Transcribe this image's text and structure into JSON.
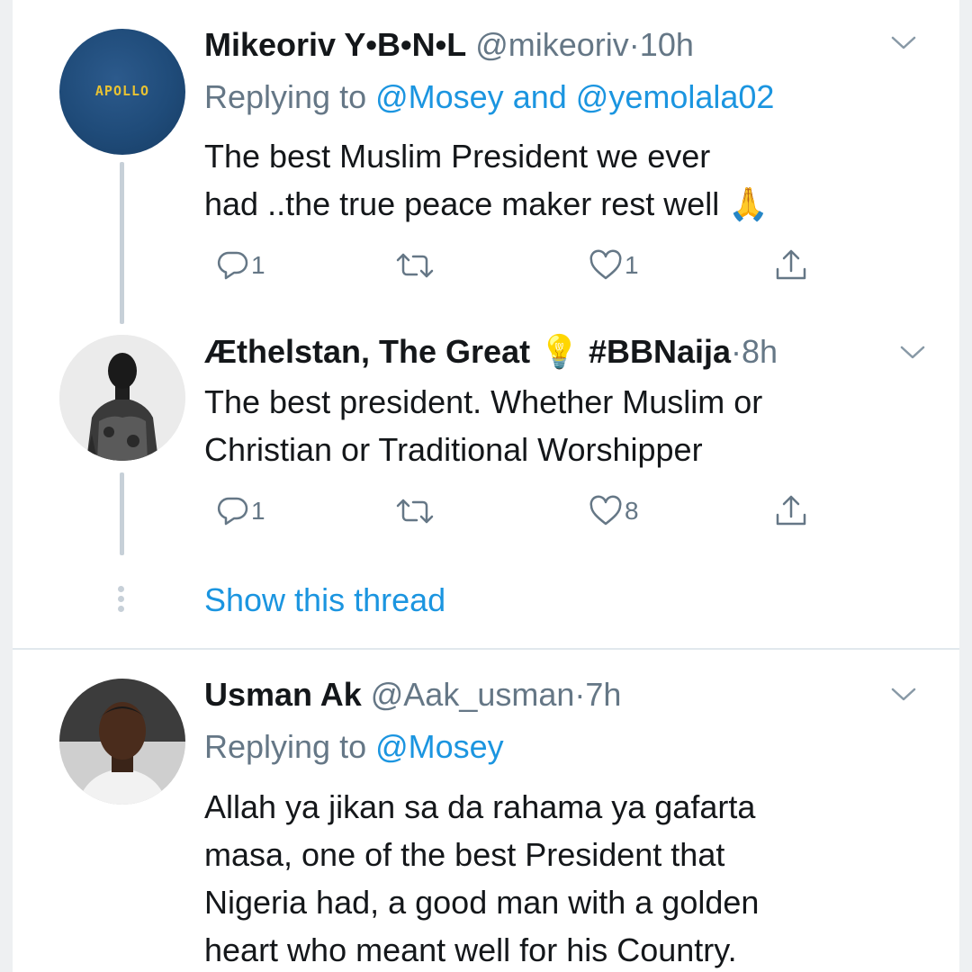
{
  "tweets": [
    {
      "name": "Mikeoriv Y•B•N•L",
      "handle": "@mikeoriv",
      "sep": "·",
      "time": "10h",
      "replying_prefix": "Replying to ",
      "replying_mentions": [
        "@Mosey",
        "and",
        "@yemolala02"
      ],
      "body_lines": [
        "The best Muslim President we ever",
        "had ..the true peace maker rest well"
      ],
      "emoji": "🙏",
      "avatar_text": "APOLLO",
      "reply_count": "1",
      "like_count": "1"
    },
    {
      "name": "Æthelstan, The Great",
      "emoji": "💡",
      "hashtag": "#BBNaija",
      "sep": "·",
      "time": "8h",
      "body_lines": [
        "The best president. Whether Muslim or",
        "Christian or Traditional Worshipper"
      ],
      "reply_count": "1",
      "like_count": "8"
    },
    {
      "name": "Usman Ak",
      "handle": "@Aak_usman",
      "sep": "·",
      "time": "7h",
      "replying_prefix": "Replying to ",
      "replying_mentions": [
        "@Mosey"
      ],
      "body_lines": [
        "Allah ya jikan sa da rahama ya gafarta",
        "masa, one of the best President that",
        "Nigeria had, a good man with a golden",
        "heart who meant well for his Country."
      ]
    }
  ],
  "show_thread": "Show this thread",
  "icons": [
    "reply-icon",
    "retweet-icon",
    "like-icon",
    "share-icon",
    "chevron-down-icon"
  ],
  "colors": {
    "link": "#1b95e0",
    "meta": "#657786",
    "thread_line": "#c7d0d8"
  }
}
